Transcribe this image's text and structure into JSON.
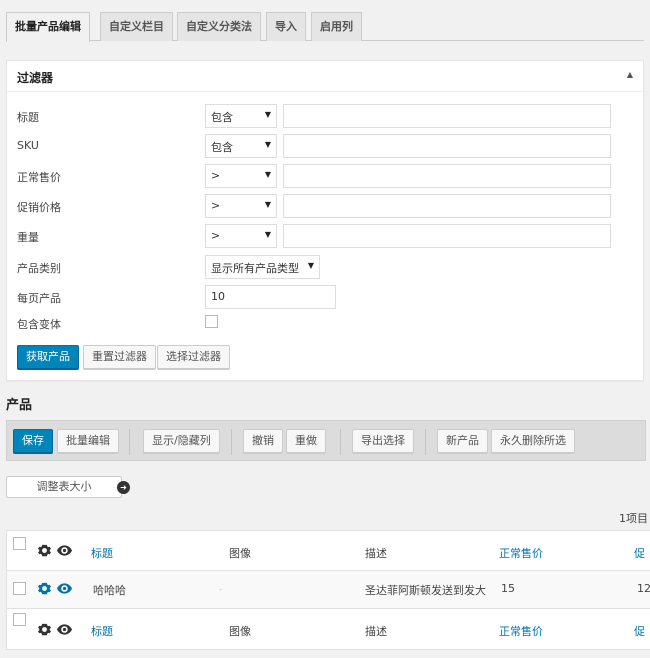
{
  "tabs": [
    "批量产品编辑",
    "自定义栏目",
    "自定义分类法",
    "导入",
    "启用列"
  ],
  "filter": {
    "title": "过滤器",
    "rows": [
      {
        "label": "标题",
        "op": "包含"
      },
      {
        "label": "SKU",
        "op": "包含"
      },
      {
        "label": "正常售价",
        "op": ">"
      },
      {
        "label": "促销价格",
        "op": ">"
      },
      {
        "label": "重量",
        "op": ">"
      }
    ],
    "category_label": "产品类别",
    "category_select": "显示所有产品类型",
    "per_page_label": "每页产品",
    "per_page_value": "10",
    "variants_label": "包含变体",
    "buttons": {
      "get": "获取产品",
      "reset": "重置过滤器",
      "choose": "选择过滤器"
    }
  },
  "products": {
    "title": "产品",
    "toolbar": {
      "save": "保存",
      "bulk_edit": "批量编辑",
      "show_hide": "显示/隐藏列",
      "undo": "撤销",
      "redo": "重做",
      "export": "导出选择",
      "new": "新产品",
      "delete": "永久删除所选"
    },
    "resize": "调整表大小",
    "count": "1项目",
    "columns": [
      "标题",
      "图像",
      "描述",
      "正常售价",
      "促"
    ],
    "row": {
      "title": "哈哈哈",
      "image": "-",
      "desc": "圣达菲阿斯顿发送到发大",
      "price": "15",
      "sale": "12"
    }
  },
  "colors": {
    "primary": "#0085ba",
    "link": "#0073aa"
  }
}
